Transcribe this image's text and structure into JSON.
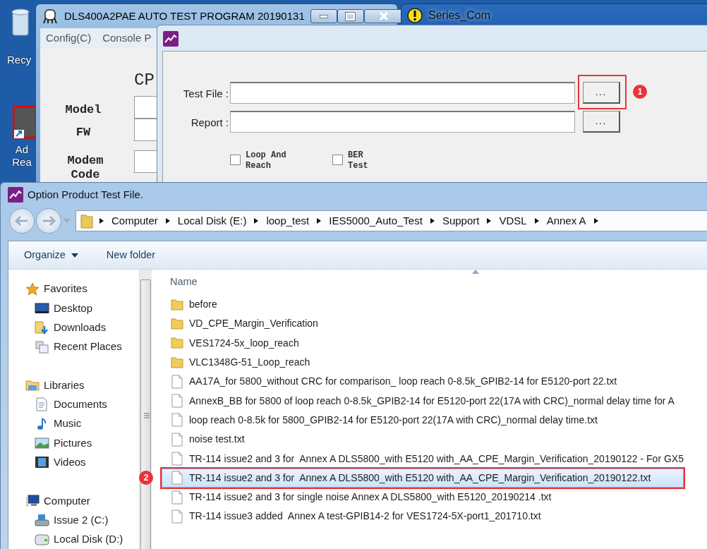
{
  "desktop_icons": [
    {
      "lines": [
        "Recy"
      ]
    },
    {
      "lines": [
        "Ad",
        "Rea"
      ]
    }
  ],
  "main_window": {
    "title": "DLS400A2PAE AUTO TEST PROGRAM 20190131",
    "menu": [
      "Config(C)",
      "Console P"
    ],
    "heading": "CP",
    "fields": [
      {
        "label": "Model"
      },
      {
        "label": "FW"
      },
      {
        "label": "Modem Code"
      }
    ]
  },
  "series_window": {
    "title": "Series_Com"
  },
  "test_dialog": {
    "rows": [
      {
        "label": "Test File :",
        "button": "...",
        "highlighted": true,
        "callout": "1"
      },
      {
        "label": "Report :",
        "button": "...",
        "highlighted": false
      }
    ],
    "checkboxes": [
      {
        "label": "Loop And Reach",
        "checked": false
      },
      {
        "label": "BER Test",
        "checked": false
      }
    ]
  },
  "file_dialog": {
    "title": "Option Product Test File.",
    "breadcrumb": [
      "Computer",
      "Local Disk (E:)",
      "loop_test",
      "IES5000_Auto_Test",
      "Support",
      "VDSL",
      "Annex A"
    ],
    "toolbar": [
      {
        "label": "Organize",
        "dropdown": true
      },
      {
        "label": "New folder",
        "dropdown": false
      }
    ],
    "nav": [
      {
        "label": "Favorites",
        "children": [
          {
            "label": "Desktop"
          },
          {
            "label": "Downloads"
          },
          {
            "label": "Recent Places"
          }
        ]
      },
      {
        "label": "Libraries",
        "children": [
          {
            "label": "Documents"
          },
          {
            "label": "Music"
          },
          {
            "label": "Pictures"
          },
          {
            "label": "Videos"
          }
        ]
      },
      {
        "label": "Computer",
        "children": [
          {
            "label": "Issue 2 (C:)"
          },
          {
            "label": "Local Disk (D:)"
          }
        ]
      }
    ],
    "column": "Name",
    "files": [
      {
        "name": "before",
        "kind": "folder",
        "selected": false
      },
      {
        "name": "VD_CPE_Margin_Verification",
        "kind": "folder",
        "selected": false
      },
      {
        "name": "VES1724-5x_loop_reach",
        "kind": "folder",
        "selected": false
      },
      {
        "name": "VLC1348G-51_Loop_reach",
        "kind": "folder",
        "selected": false
      },
      {
        "name": "AA17A_for 5800_without CRC for comparison_ loop reach 0-8.5k_GPIB2-14 for E5120-port 22.txt",
        "kind": "file",
        "selected": false
      },
      {
        "name": "AnnexB_BB for 5800 of loop reach 0-8.5k_GPIB2-14 for E5120-port 22(17A with CRC)_normal delay time for A",
        "kind": "file",
        "selected": false
      },
      {
        "name": "loop reach 0-8.5k for 5800_GPIB2-14 for E5120-port 22(17A with CRC)_normal delay time.txt",
        "kind": "file",
        "selected": false
      },
      {
        "name": "noise test.txt",
        "kind": "file",
        "selected": false
      },
      {
        "name": "TR-114 issue2 and 3 for  Annex A DLS5800_with E5120 with_AA_CPE_Margin_Verification_20190122 - For GX5",
        "kind": "file",
        "selected": false
      },
      {
        "name": "TR-114 issue2 and 3 for  Annex A DLS5800_with E5120 with_AA_CPE_Margin_Verification_20190122.txt",
        "kind": "file",
        "selected": true,
        "callout": "2"
      },
      {
        "name": "TR-114 issue2 and 3 for single noise Annex A DLS5800_with E5120_20190214 .txt",
        "kind": "file",
        "selected": false
      },
      {
        "name": "TR-114 issue3 added  Annex A test-GPIB14-2 for VES1724-5X-port1_201710.txt",
        "kind": "file",
        "selected": false
      }
    ]
  }
}
